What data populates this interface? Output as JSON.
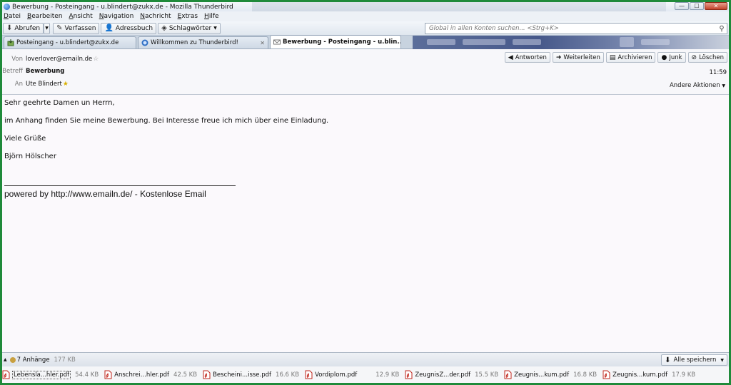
{
  "window": {
    "title": "Bewerbung - Posteingang - u.blindert@zukx.de - Mozilla Thunderbird",
    "buttons": {
      "minimize": "—",
      "maximize": "☐",
      "close": "✕"
    }
  },
  "menubar": [
    {
      "label": "Datei",
      "accel": "D",
      "rest": "atei"
    },
    {
      "label": "Bearbeiten",
      "accel": "B",
      "rest": "earbeiten"
    },
    {
      "label": "Ansicht",
      "accel": "A",
      "rest": "nsicht"
    },
    {
      "label": "Navigation",
      "accel": "N",
      "rest": "avigation"
    },
    {
      "label": "Nachricht",
      "accel": "N",
      "rest": "achricht"
    },
    {
      "label": "Extras",
      "accel": "E",
      "rest": "xtras"
    },
    {
      "label": "Hilfe",
      "accel": "H",
      "rest": "ilfe"
    }
  ],
  "toolbar": {
    "get_mail": "Abrufen",
    "write": "Verfassen",
    "address_book": "Adressbuch",
    "tags": "Schlagwörter",
    "search_placeholder": "Global in allen Konten suchen... <Strg+K>"
  },
  "tabs": [
    {
      "label": "Posteingang - u.blindert@zukx.de",
      "closable": false
    },
    {
      "label": "Willkommen zu Thunderbird!",
      "closable": true
    },
    {
      "label": "Bewerbung - Posteingang - u.blin...",
      "closable": true,
      "active": true
    }
  ],
  "message": {
    "from_label": "Von",
    "from": "loverlover@emailn.de",
    "subject_label": "Betreff",
    "subject": "Bewerbung",
    "to_label": "An",
    "to": "Ute Blindert",
    "time": "11:59",
    "other_actions": "Andere Aktionen",
    "actions": {
      "reply": "Antworten",
      "forward": "Weiterleiten",
      "archive": "Archivieren",
      "junk": "Junk",
      "delete": "Löschen"
    },
    "body": {
      "greeting": "Sehr geehrte Damen un Herrn,",
      "line1": "im Anhang finden Sie meine Bewerbung. Bei Interesse freue ich mich über eine Einladung.",
      "closing": "Viele Grüße",
      "signature": "Björn Hölscher",
      "footer": "powered by http://www.emailn.de/ - Kostenlose Email"
    }
  },
  "attachments": {
    "count_label": "7 Anhänge",
    "total_size": "177 KB",
    "save_all": "Alle speichern",
    "items": [
      {
        "name": "Lebensla...hler.pdf",
        "size": "54.4 KB"
      },
      {
        "name": "Anschrei...hler.pdf",
        "size": "42.5 KB"
      },
      {
        "name": "Bescheini...isse.pdf",
        "size": "16.6 KB"
      },
      {
        "name": "Vordiplom.pdf",
        "size": "12.9 KB"
      },
      {
        "name": "ZeugnisZ...der.pdf",
        "size": "15.5 KB"
      },
      {
        "name": "Zeugnis...kum.pdf",
        "size": "16.8 KB"
      },
      {
        "name": "Zeugnis...kum.pdf",
        "size": "17.9 KB"
      }
    ]
  },
  "colors": {
    "frame": "#1f8a3a",
    "pdf_red": "#c0261c",
    "star_yellow": "#d9b000"
  }
}
